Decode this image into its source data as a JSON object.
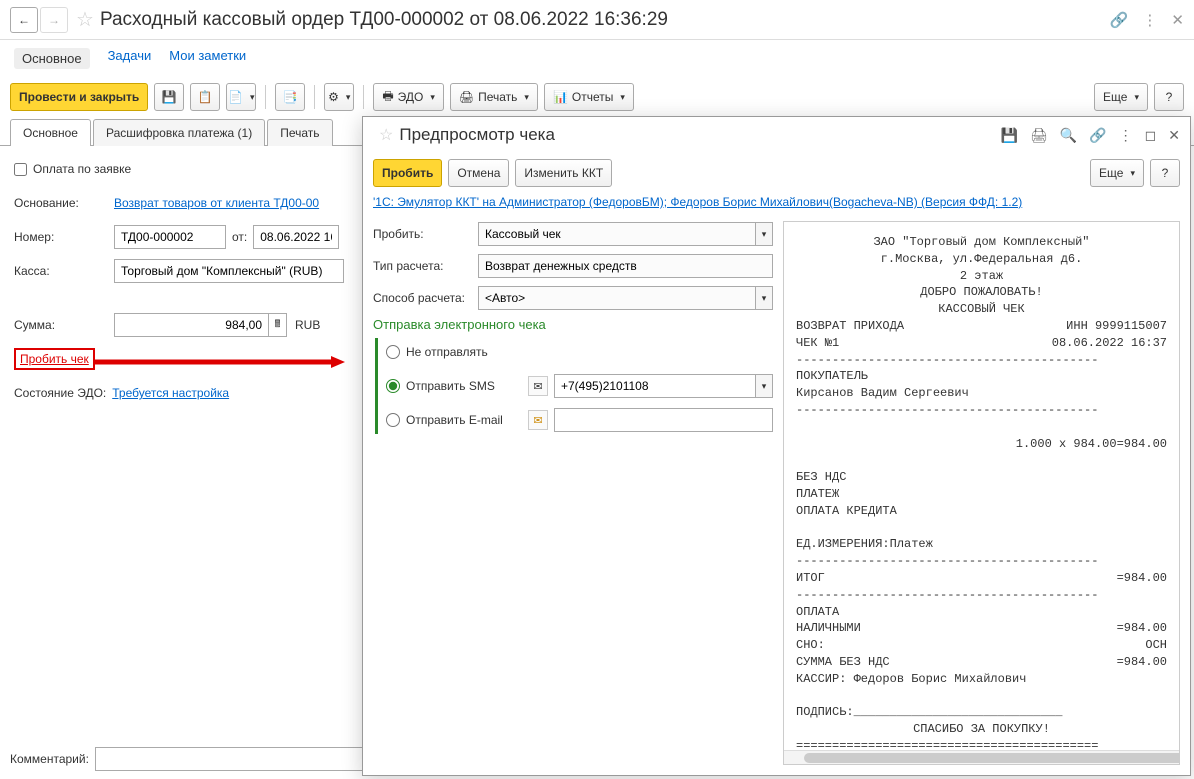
{
  "header": {
    "title": "Расходный кассовый ордер ТД00-000002 от 08.06.2022 16:36:29"
  },
  "navTabs": {
    "main": "Основное",
    "tasks": "Задачи",
    "notes": "Мои заметки"
  },
  "toolbar": {
    "postClose": "Провести и закрыть",
    "edo": "ЭДО",
    "print": "Печать",
    "reports": "Отчеты",
    "more": "Еще"
  },
  "subTabs": {
    "main": "Основное",
    "detail": "Расшифровка платежа (1)",
    "print": "Печать"
  },
  "form": {
    "payByRequest": "Оплата по заявке",
    "basisLabel": "Основание:",
    "basisLink": "Возврат товаров от клиента ТД00-00",
    "numberLabel": "Номер:",
    "numberValue": "ТД00-000002",
    "fromLabel": "от:",
    "dateValue": "08.06.2022 16",
    "cashLabel": "Касса:",
    "cashValue": "Торговый дом \"Комплексный\" (RUB)",
    "sumLabel": "Сумма:",
    "sumValue": "984,00",
    "sumCurrency": "RUB",
    "punchCheck": "Пробить чек",
    "edoStateLabel": "Состояние ЭДО:",
    "edoStateLink": "Требуется настройка",
    "commentLabel": "Комментарий:"
  },
  "panel": {
    "title": "Предпросмотр чека",
    "punch": "Пробить",
    "cancel": "Отмена",
    "changeKKT": "Изменить ККТ",
    "more": "Еще",
    "info": "'1С: Эмулятор ККТ' на Администратор (ФедоровБМ); Федоров Борис Михайлович(Bogacheva-NB) (Версия ФФД: 1.2)",
    "punchLabel": "Пробить:",
    "punchValue": "Кассовый чек",
    "calcTypeLabel": "Тип расчета:",
    "calcTypeValue": "Возврат денежных средств",
    "calcMethodLabel": "Способ расчета:",
    "calcMethodValue": "<Авто>",
    "sendHead": "Отправка электронного чека",
    "noSend": "Не отправлять",
    "sendSMS": "Отправить SMS",
    "phoneValue": "+7(495)2101108",
    "sendEmail": "Отправить E-mail"
  },
  "receipt": {
    "company": "ЗАО \"Торговый дом Комплексный\"",
    "addr": "г.Москва, ул.Федеральная д6.",
    "floor": "2 этаж",
    "welcome": "ДОБРО ПОЖАЛОВАТЬ!",
    "checkType": "КАССОВЫЙ ЧЕК",
    "returnLabel": "ВОЗВРАТ ПРИХОДА",
    "innLabel": "ИНН 9999115007",
    "checkNo": "ЧЕК №1",
    "checkDate": "08.06.2022 16:37",
    "buyerLabel": "ПОКУПАТЕЛЬ",
    "buyerName": " Кирсанов Вадим Сергеевич",
    "lineQty": "1.000 x 984.00=984.00",
    "noVat": "БЕЗ НДС",
    "payment": "ПЛАТЕЖ",
    "creditPay": "ОПЛАТА КРЕДИТА",
    "unit": "ЕД.ИЗМЕРЕНИЯ:Платеж",
    "totalLabel": "ИТОГ",
    "totalValue": "=984.00",
    "payHead": "ОПЛАТА",
    "cashLabel": " НАЛИЧНЫМИ",
    "cashValue": "=984.00",
    "snoLabel": "СНО:",
    "snoValue": "ОСН",
    "sumNoVatLabel": " СУММА БЕЗ НДС",
    "sumNoVatValue": "=984.00",
    "cashier": "КАССИР: Федоров Борис Михайлович",
    "sign": "ПОДПИСЬ:_____________________________",
    "thanks": "СПАСИБО ЗА ПОКУПКУ!"
  }
}
